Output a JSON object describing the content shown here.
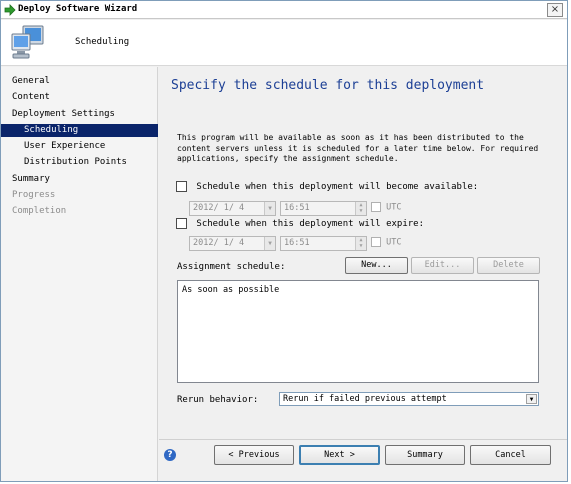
{
  "window": {
    "title": "Deploy Software Wizard",
    "close_label": "×"
  },
  "header": {
    "title": "Scheduling",
    "icon": "computer-monitor-icon"
  },
  "sidebar": {
    "items": [
      {
        "label": "General",
        "level": 0,
        "state": "normal"
      },
      {
        "label": "Content",
        "level": 0,
        "state": "normal"
      },
      {
        "label": "Deployment Settings",
        "level": 0,
        "state": "normal"
      },
      {
        "label": "Scheduling",
        "level": 1,
        "state": "active"
      },
      {
        "label": "User Experience",
        "level": 1,
        "state": "normal"
      },
      {
        "label": "Distribution Points",
        "level": 1,
        "state": "normal"
      },
      {
        "label": "Summary",
        "level": 0,
        "state": "normal"
      },
      {
        "label": "Progress",
        "level": 0,
        "state": "disabled"
      },
      {
        "label": "Completion",
        "level": 0,
        "state": "disabled"
      }
    ]
  },
  "main": {
    "heading": "Specify the schedule for this deployment",
    "description": "This program will be available as soon as it has been distributed to the content servers unless it is scheduled for a later time below. For required applications, specify the assignment schedule.",
    "available": {
      "label": "Schedule when this deployment will become available:",
      "checked": false,
      "date": "2012/ 1/ 4",
      "time": "16:51",
      "utc_label": "UTC"
    },
    "expire": {
      "label": "Schedule when this deployment will expire:",
      "checked": false,
      "date": "2012/ 1/ 4",
      "time": "16:51",
      "utc_label": "UTC"
    },
    "assignment": {
      "label": "Assignment schedule:",
      "new_label": "New...",
      "edit_label": "Edit...",
      "delete_label": "Delete",
      "items": [
        "As soon as possible"
      ]
    },
    "rerun": {
      "label": "Rerun behavior:",
      "value": "Rerun if failed previous attempt"
    }
  },
  "footer": {
    "help_label": "?",
    "previous_label": "< Previous",
    "next_label": "Next >",
    "summary_label": "Summary",
    "cancel_label": "Cancel"
  },
  "colors": {
    "accent": "#0a246a",
    "heading": "#1c3f95",
    "help": "#2f68c4"
  }
}
